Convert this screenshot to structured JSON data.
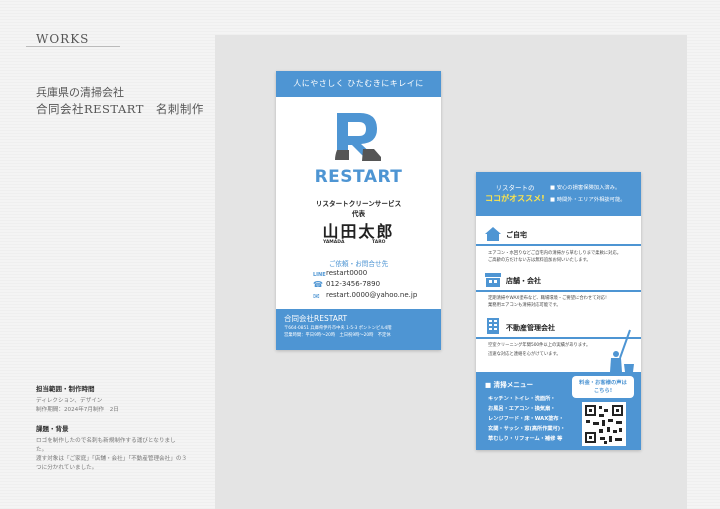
{
  "header": {
    "section": "WORKS",
    "client": "兵庫県の清掃会社",
    "project": "合同会社RESTART　名刺制作"
  },
  "info": {
    "scope_heading": "担当範囲・制作時間",
    "scope_text": "ディレクション、デザイン",
    "time_text": "制作期間：2024年7月制作　2日",
    "issue_heading": "課題・背景",
    "issue_lines": [
      "ロゴを制作したので名刺も新規制作する運びとなりまし",
      "た。",
      "渡す対象は「ご家庭」「店舗・会社」「不動産管理会社」の３",
      "つに分かれていました。"
    ]
  },
  "front": {
    "tagline": "人にやさしく ひたむきにキレイに",
    "brand": "RESTART",
    "title": "リスタートクリーンサービス",
    "role": "代表",
    "name": "山田太郎",
    "romaji_family": "YAMADA",
    "romaji_given": "TARO",
    "contact_heading": "ご依頼・お問合せ先",
    "line_label": "LINE",
    "line_id": "restart0000",
    "phone": "012-3456-7890",
    "email": "restart.0000@yahoo.ne.jp",
    "company": "合同会社RESTART",
    "address": "〒664-0851 兵庫県伊丹市中央 1-5-3 ポントンビル4階",
    "hours": "営業時間：平日9時〜20時　土日祝9時〜20時　不定休"
  },
  "back": {
    "headline1": "リスタートの",
    "headline2": "ココがオススメ!",
    "points": [
      "■ 安心の損害保険加入済み。",
      "■ 時間外・エリア外相談可能。"
    ],
    "sections": [
      {
        "title": "ご自宅",
        "lines": [
          "エアコン・水回りなどご自宅内の清掃から草むしりまで柔軟に対応。",
          "ご高齢の方だけない方は無料追加お伺いいたします。"
        ]
      },
      {
        "title": "店舗・会社",
        "lines": [
          "定期清掃やWAX塗布など、職場環境・ご要望に合わせて対応!",
          "業務用エアコンも清掃対応可能です。"
        ]
      },
      {
        "title": "不動産管理会社",
        "lines": [
          "空室クリーニング年間500件以上の実績があります。",
          "迅速な対応と連絡を心がけています。"
        ]
      }
    ],
    "menu_heading": "■ 清掃メニュー",
    "menu_items": [
      "キッチン・トイレ・洗面所・",
      "お風呂・エアコン・換気扇・",
      "レンジフード・床・WAX塗布・",
      "玄関・サッシ・窓(高所作業可)・",
      "草むしり・リフォーム・補修 等"
    ],
    "bubble_line1": "料金・お客様の声は",
    "bubble_line2": "こちら!"
  }
}
